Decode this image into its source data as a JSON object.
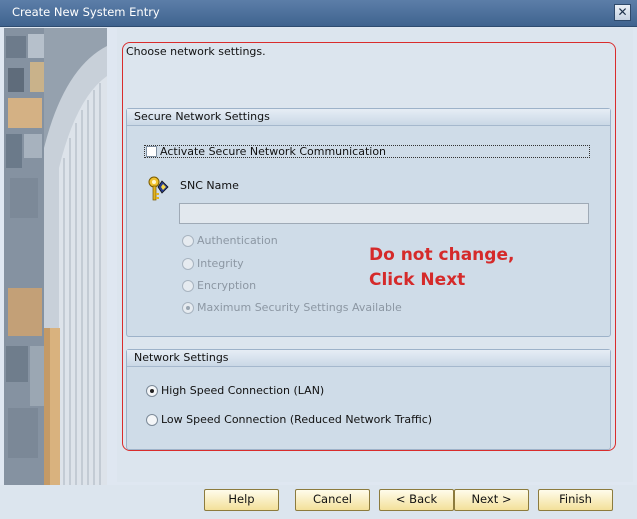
{
  "window": {
    "title": "Create New System Entry",
    "close_glyph": "✕"
  },
  "instruction": "Choose network settings.",
  "secure": {
    "header": "Secure Network Settings",
    "checkbox_label": "Activate Secure Network Communication",
    "checked": false,
    "snc_label": "SNC Name",
    "snc_value": "",
    "options": [
      {
        "label": "Authentication",
        "selected": false,
        "disabled": true
      },
      {
        "label": "Integrity",
        "selected": false,
        "disabled": true
      },
      {
        "label": "Encryption",
        "selected": false,
        "disabled": true
      },
      {
        "label": "Maximum Security Settings Available",
        "selected": true,
        "disabled": true
      }
    ]
  },
  "network": {
    "header": "Network Settings",
    "options": [
      {
        "label": "High Speed Connection (LAN)",
        "selected": true
      },
      {
        "label": "Low Speed Connection (Reduced Network Traffic)",
        "selected": false
      }
    ]
  },
  "annotation": {
    "line1": "Do not change,",
    "line2": "Click Next"
  },
  "buttons": {
    "help": "Help",
    "cancel": "Cancel",
    "back": "< Back",
    "next": "Next >",
    "finish": "Finish"
  },
  "colors": {
    "annotation": "#D52A2A",
    "button_fill": "#F3E09A",
    "title_bar": "#4A6D98"
  },
  "icons": {
    "snc": "key-icon"
  }
}
